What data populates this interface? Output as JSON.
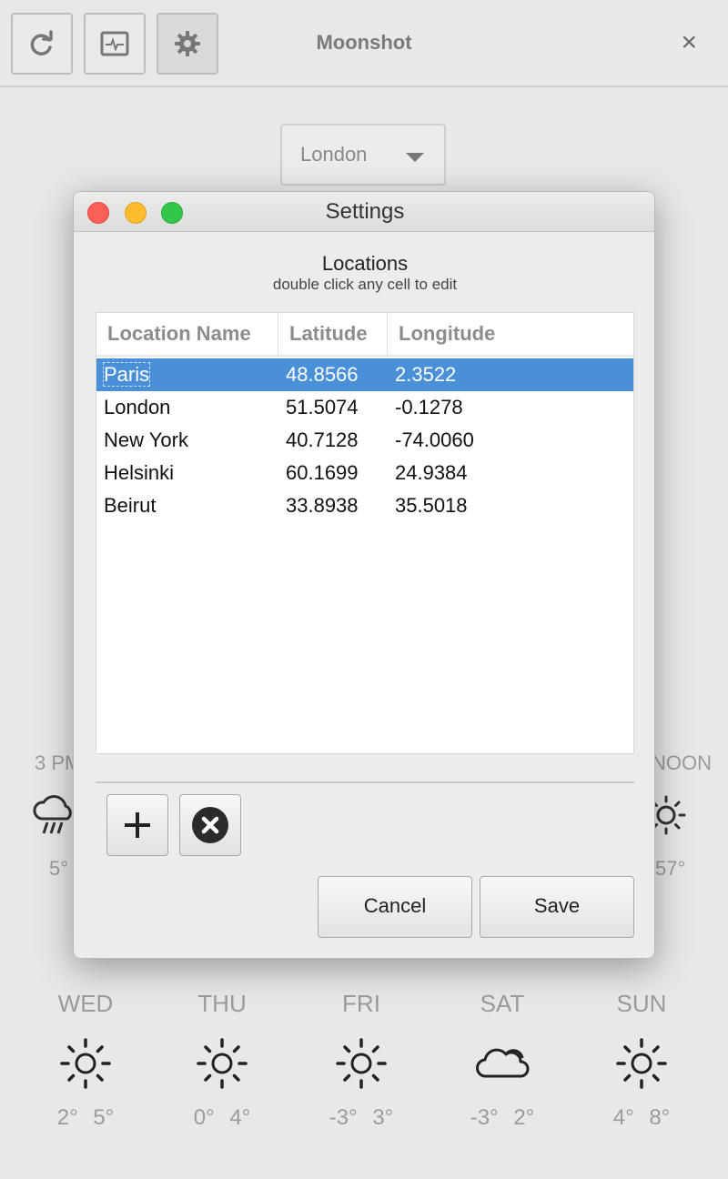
{
  "window": {
    "title": "Moonshot"
  },
  "toolbar": {
    "refresh_icon": "refresh-icon",
    "monitor_icon": "monitor-icon",
    "settings_icon": "gear-icon",
    "close_label": "×"
  },
  "location_select": {
    "value": "London"
  },
  "background_forecast": {
    "hourly_left_label": "3 PM",
    "hourly_left_temp": "5°",
    "hourly_right_label": "NOON",
    "hourly_right_temp": "57°",
    "days": [
      {
        "name": "WED",
        "icon": "sun-icon",
        "temps": "2° 5°"
      },
      {
        "name": "THU",
        "icon": "sun-icon",
        "temps": "0° 4°"
      },
      {
        "name": "FRI",
        "icon": "sun-icon",
        "temps": "-3° 3°"
      },
      {
        "name": "SAT",
        "icon": "cloud-icon",
        "temps": "-3° 2°"
      },
      {
        "name": "SUN",
        "icon": "sun-icon",
        "temps": "4° 8°"
      }
    ]
  },
  "settings_dialog": {
    "title": "Settings",
    "section_title": "Locations",
    "section_subtitle": "double click any cell to edit",
    "columns": [
      "Location Name",
      "Latitude",
      "Longitude"
    ],
    "rows": [
      {
        "name": "Paris",
        "latitude": "48.8566",
        "longitude": "2.3522",
        "selected": true
      },
      {
        "name": "London",
        "latitude": "51.5074",
        "longitude": "-0.1278",
        "selected": false
      },
      {
        "name": "New York",
        "latitude": "40.7128",
        "longitude": "-74.0060",
        "selected": false
      },
      {
        "name": "Helsinki",
        "latitude": "60.1699",
        "longitude": "24.9384",
        "selected": false
      },
      {
        "name": "Beirut",
        "latitude": "33.8938",
        "longitude": "35.5018",
        "selected": false
      }
    ],
    "add_icon": "plus-icon",
    "remove_icon": "remove-circle-icon",
    "cancel_label": "Cancel",
    "save_label": "Save"
  },
  "colors": {
    "selection": "#4a90d9",
    "traffic_close": "#fc5f57",
    "traffic_minimize": "#fdbc2e",
    "traffic_maximize": "#33c748"
  }
}
